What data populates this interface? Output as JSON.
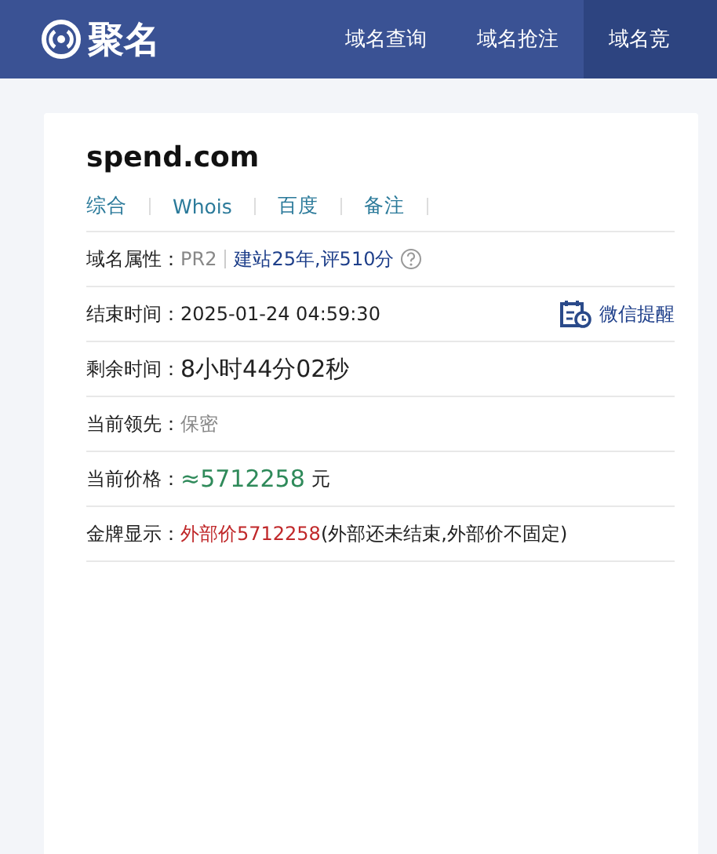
{
  "header": {
    "logo_text": "聚名",
    "nav": [
      {
        "label": "域名查询",
        "selected": false
      },
      {
        "label": "域名抢注",
        "selected": false
      },
      {
        "label": "域名竞",
        "selected": true
      }
    ]
  },
  "domain": {
    "name": "spend.com",
    "links": [
      "综合",
      "Whois",
      "百度",
      "备注"
    ],
    "rows": [
      {
        "kind": "attr",
        "label": "域名属性：",
        "pr": "PR2",
        "info": "建站25年,评510分"
      },
      {
        "kind": "end",
        "label": "结束时间：",
        "value": "2025-01-24 04:59:30",
        "action": "微信提醒"
      },
      {
        "kind": "remain",
        "label": "剩余时间：",
        "value": "8小时44分02秒"
      },
      {
        "kind": "leader",
        "label": "当前领先：",
        "value": "保密"
      },
      {
        "kind": "price",
        "label": "当前价格：",
        "value": "≈5712258",
        "unit": "元"
      },
      {
        "kind": "gold",
        "label": "金牌显示：",
        "value": "外部价5712258",
        "note": "(外部还未结束,外部价不固定)"
      }
    ]
  }
}
